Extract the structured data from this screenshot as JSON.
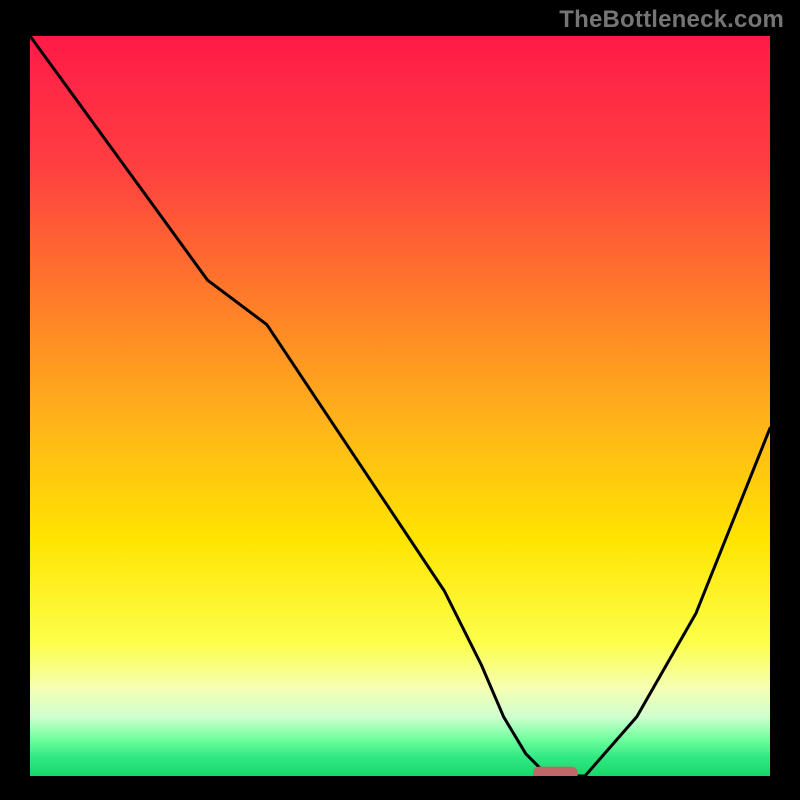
{
  "watermark": {
    "text": "TheBottleneck.com"
  },
  "chart_data": {
    "type": "line",
    "title": "",
    "xlabel": "",
    "ylabel": "",
    "xlim": [
      0,
      100
    ],
    "ylim": [
      0,
      100
    ],
    "curve": {
      "x": [
        0,
        8,
        16,
        24,
        32,
        40,
        48,
        56,
        61,
        64,
        67,
        70,
        75,
        82,
        90,
        100
      ],
      "y": [
        100,
        89,
        78,
        67,
        61,
        49,
        37,
        25,
        15,
        8,
        3,
        0,
        0,
        8,
        22,
        47
      ]
    },
    "marker": {
      "x": 71,
      "y": 0,
      "width": 6,
      "height": 2,
      "color": "#c06868"
    },
    "background": {
      "gradient_stops": [
        {
          "offset": 0.0,
          "color": "#ff1a48"
        },
        {
          "offset": 0.18,
          "color": "#ff4040"
        },
        {
          "offset": 0.35,
          "color": "#ff7a2a"
        },
        {
          "offset": 0.52,
          "color": "#ffb31a"
        },
        {
          "offset": 0.68,
          "color": "#ffe400"
        },
        {
          "offset": 0.82,
          "color": "#fcff4a"
        },
        {
          "offset": 0.88,
          "color": "#f6ffb0"
        },
        {
          "offset": 0.92,
          "color": "#d0ffcf"
        },
        {
          "offset": 0.95,
          "color": "#70ff9f"
        },
        {
          "offset": 0.975,
          "color": "#30e882"
        },
        {
          "offset": 1.0,
          "color": "#18d86a"
        }
      ]
    }
  }
}
